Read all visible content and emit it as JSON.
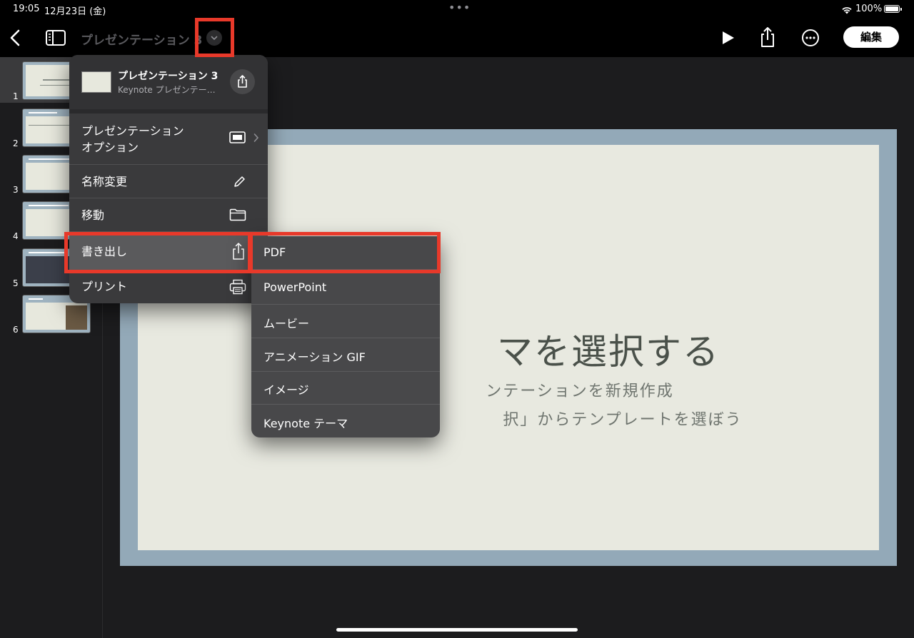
{
  "status_bar": {
    "time": "19:05",
    "date": "12月23日 (金)",
    "battery": "100%"
  },
  "toolbar": {
    "title": "プレゼンテーション 3",
    "edit_label": "編集"
  },
  "navigator": {
    "slides": [
      {
        "number": "1"
      },
      {
        "number": "2"
      },
      {
        "number": "3"
      },
      {
        "number": "4"
      },
      {
        "number": "5"
      },
      {
        "number": "6"
      }
    ],
    "selected": 1
  },
  "slide": {
    "title": "マを選択する",
    "subtitle_1": "ンテーションを新規作成",
    "subtitle_2": "択」からテンプレートを選ぼう"
  },
  "menu": {
    "header_title": "プレゼンテーション 3",
    "header_subtitle": "Keynote プレゼンテー…",
    "items": [
      {
        "label_line1": "プレゼンテーション",
        "label_line2": "オプション",
        "icon": "presentation-options-icon"
      },
      {
        "label": "名称変更",
        "icon": "pencil-icon"
      },
      {
        "label": "移動",
        "icon": "folder-icon"
      },
      {
        "label": "書き出し",
        "icon": "share-icon"
      },
      {
        "label": "プリント",
        "icon": "printer-icon"
      }
    ]
  },
  "export_submenu": {
    "items": [
      {
        "label": "PDF"
      },
      {
        "label": "PowerPoint"
      },
      {
        "label": "ムービー"
      },
      {
        "label": "アニメーション GIF"
      },
      {
        "label": "イメージ"
      },
      {
        "label": "Keynote テーマ"
      }
    ]
  },
  "colors": {
    "highlight": "#e8392a",
    "toolbar_bg": "#000000",
    "menu_bg": "#3a3a3c",
    "slide_border": "#93a9b8",
    "slide_bg": "#e8e9e0"
  }
}
